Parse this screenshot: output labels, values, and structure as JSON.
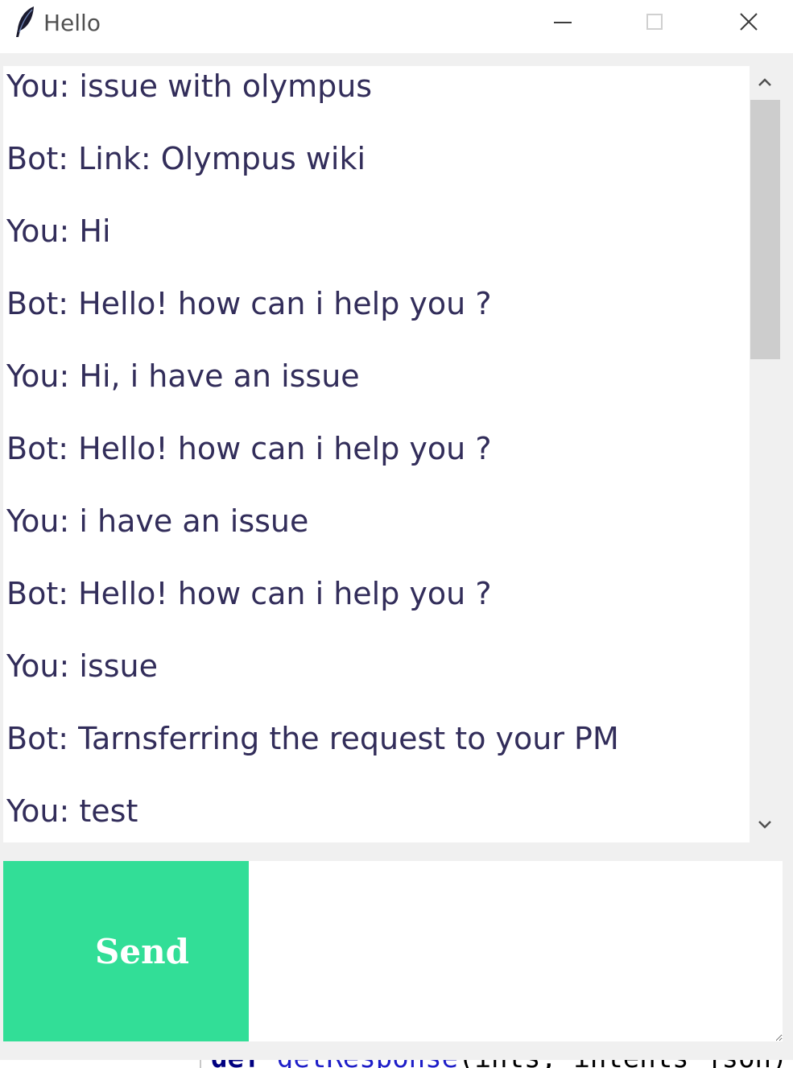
{
  "window": {
    "title": "Hello",
    "icon": "feather-icon",
    "controls": {
      "minimize_icon": "minimize-icon",
      "maximize_icon": "maximize-icon",
      "close_icon": "close-icon"
    }
  },
  "chat": {
    "messages": [
      "You: issue with olympus",
      "Bot: Link: Olympus wiki",
      "You: Hi",
      "Bot: Hello! how can i help you ?",
      "You: Hi, i have an issue",
      "Bot: Hello! how can i help you ?",
      "You: i have an issue",
      "Bot: Hello! how can i help you ?",
      "You: issue",
      "Bot: Tarnsferring the request to your PM",
      "You: test"
    ],
    "text_color": "#322d5a"
  },
  "scrollbar": {
    "up_icon": "chevron-up-icon",
    "down_icon": "chevron-down-icon"
  },
  "input": {
    "send_label": "Send",
    "entry_value": "",
    "send_color": "#32de97"
  },
  "background": {
    "code_keyword": "def",
    "code_function": "getResponse",
    "code_rest": "(ints, intents_json):"
  }
}
